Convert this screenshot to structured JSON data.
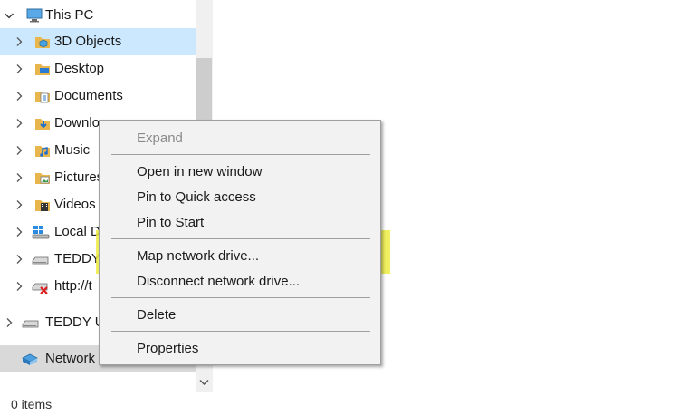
{
  "nav": {
    "items": [
      {
        "label": "This PC",
        "icon": "computer-icon",
        "state": "expanded"
      },
      {
        "label": "3D Objects",
        "icon": "3d-objects-folder-icon",
        "state": "selected"
      },
      {
        "label": "Desktop",
        "icon": "desktop-folder-icon"
      },
      {
        "label": "Documents",
        "icon": "documents-folder-icon"
      },
      {
        "label": "Downlo",
        "icon": "downloads-folder-icon"
      },
      {
        "label": "Music",
        "icon": "music-folder-icon"
      },
      {
        "label": "Pictures",
        "icon": "pictures-folder-icon"
      },
      {
        "label": "Videos",
        "icon": "videos-folder-icon"
      },
      {
        "label": "Local D",
        "icon": "windows-drive-icon"
      },
      {
        "label": "TEDDY",
        "icon": "usb-drive-icon"
      },
      {
        "label": "http://t",
        "icon": "disconnected-network-drive-icon"
      },
      {
        "label": "TEDDY U",
        "icon": "usb-drive-icon"
      },
      {
        "label": "Network",
        "icon": "network-icon",
        "state": "context-target"
      }
    ]
  },
  "status": {
    "items_count": "0 items"
  },
  "context_menu": {
    "items": [
      {
        "label": "Expand",
        "disabled": true
      },
      {
        "label": "Open in new window"
      },
      {
        "label": "Pin to Quick access"
      },
      {
        "label": "Pin to Start"
      },
      {
        "label": "Map network drive...",
        "highlighted": true
      },
      {
        "label": "Disconnect network drive..."
      },
      {
        "label": "Delete"
      },
      {
        "label": "Properties"
      }
    ]
  },
  "colors": {
    "selection": "#cce8ff",
    "highlight": "#ecec3c",
    "menu_bg": "#f2f2f2",
    "folder": "#e8b64c"
  }
}
